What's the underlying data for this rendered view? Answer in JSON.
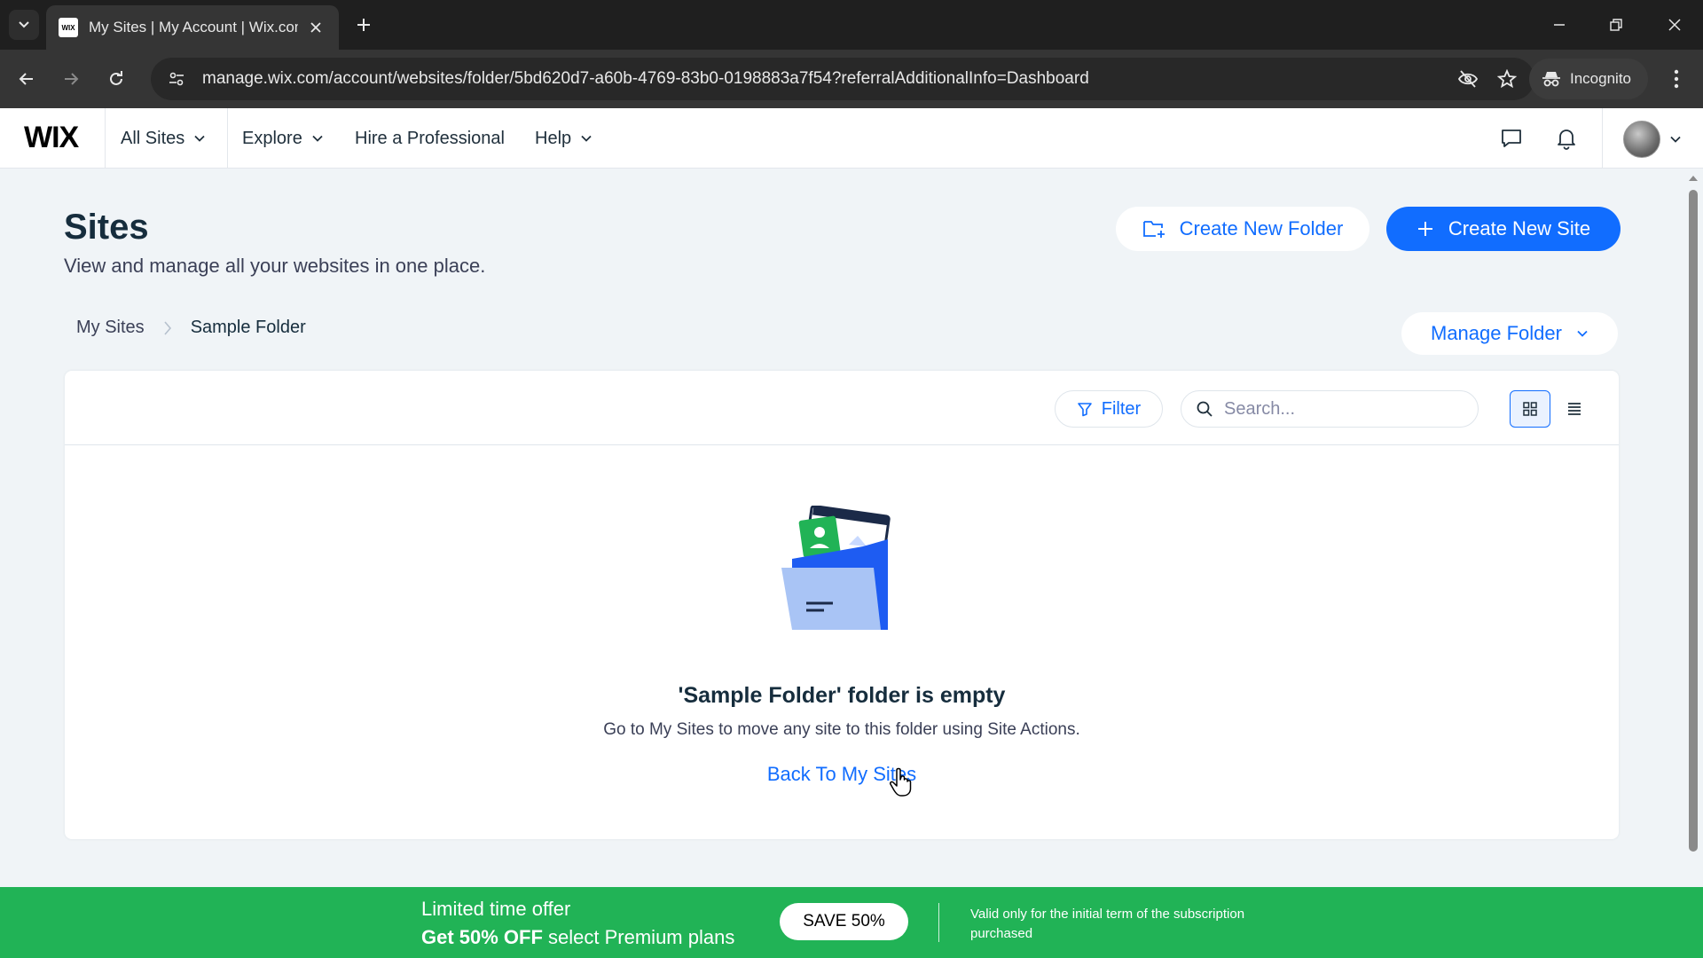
{
  "browser": {
    "tab_title": "My Sites | My Account | Wix.com",
    "favicon_text": "WIX",
    "url": "manage.wix.com/account/websites/folder/5bd620d7-a60b-4769-83b0-0198883a7f54?referralAdditionalInfo=Dashboard",
    "incognito_label": "Incognito"
  },
  "wix_nav": {
    "logo": "WIX",
    "items": [
      "All Sites",
      "Explore",
      "Hire a Professional",
      "Help"
    ]
  },
  "page": {
    "title": "Sites",
    "subtitle": "View and manage all your websites in one place.",
    "create_folder_label": "Create New Folder",
    "create_site_label": "Create New Site",
    "breadcrumb": [
      "My Sites",
      "Sample Folder"
    ],
    "manage_folder_label": "Manage Folder"
  },
  "toolbar": {
    "filter_label": "Filter",
    "search_placeholder": "Search..."
  },
  "empty_state": {
    "title": "'Sample Folder' folder is empty",
    "description": "Go to My Sites to move any site to this folder using Site Actions.",
    "link_label": "Back To My Sites"
  },
  "promo": {
    "line1": "Limited time offer",
    "line2_bold": "Get 50% OFF",
    "line2_rest": " select Premium plans",
    "button_label": "SAVE 50%",
    "note": "Valid only for the initial term of the subscription purchased"
  },
  "colors": {
    "accent": "#116dff",
    "promo_green": "#21b356",
    "page_bg": "#f0f4f7",
    "title_text": "#162d3d"
  }
}
